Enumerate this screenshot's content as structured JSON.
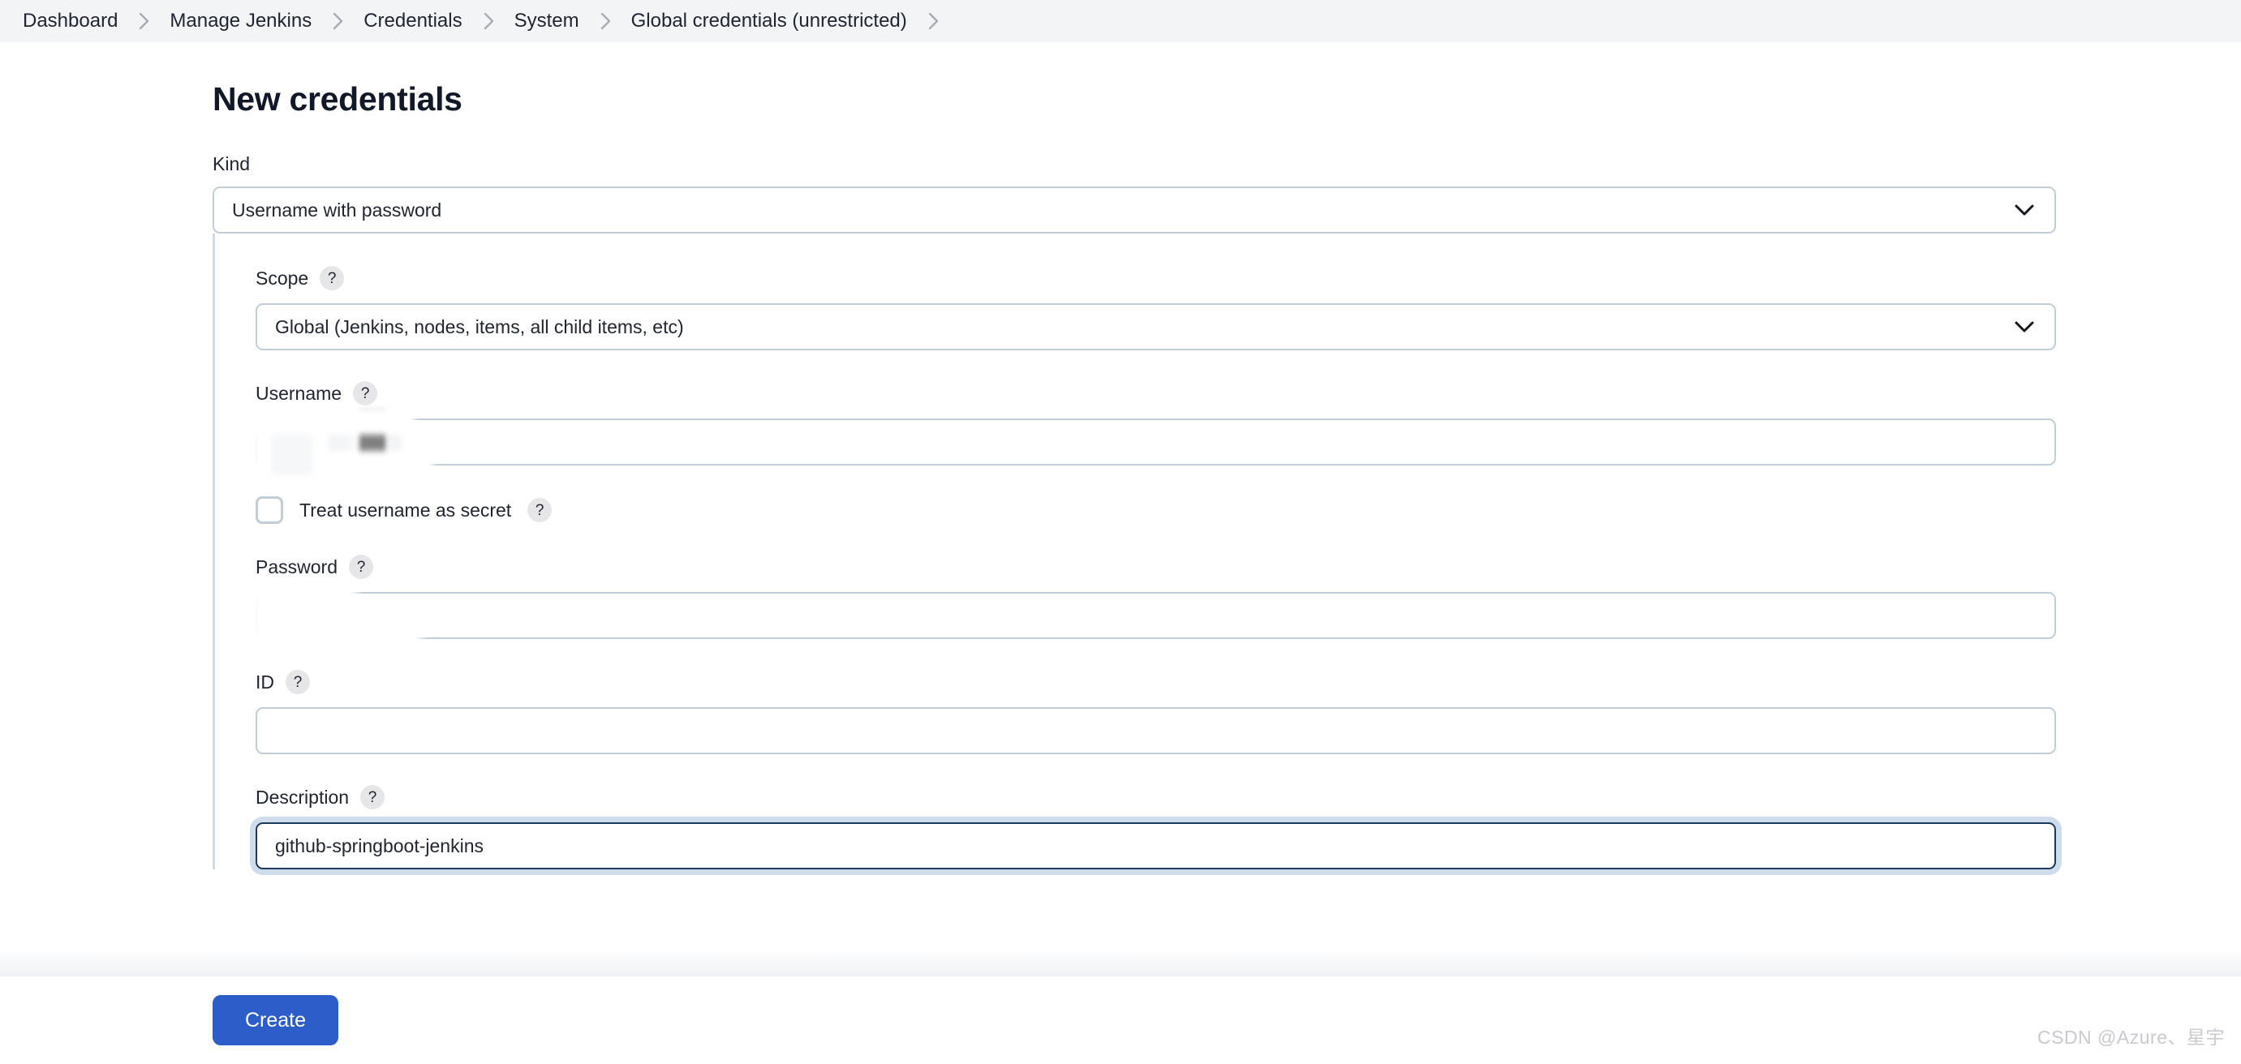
{
  "breadcrumb": {
    "items": [
      {
        "label": "Dashboard"
      },
      {
        "label": "Manage Jenkins"
      },
      {
        "label": "Credentials"
      },
      {
        "label": "System"
      },
      {
        "label": "Global credentials (unrestricted)"
      }
    ],
    "separator_icon": "chevron-right-icon"
  },
  "page": {
    "title": "New credentials"
  },
  "form": {
    "kind": {
      "label": "Kind",
      "value": "Username with password",
      "icon": "chevron-down-icon"
    },
    "scope": {
      "label": "Scope",
      "help": "?",
      "value": "Global (Jenkins, nodes, items, all child items, etc)",
      "icon": "chevron-down-icon"
    },
    "username": {
      "label": "Username",
      "help": "?",
      "value": "",
      "redacted": true
    },
    "treat_username_as_secret": {
      "label": "Treat username as secret",
      "help": "?",
      "checked": false
    },
    "password": {
      "label": "Password",
      "help": "?",
      "value": "",
      "redacted": true
    },
    "id": {
      "label": "ID",
      "help": "?",
      "value": ""
    },
    "description": {
      "label": "Description",
      "help": "?",
      "value": "github-springboot-jenkins",
      "focused": true
    }
  },
  "footer": {
    "create_label": "Create"
  },
  "watermark": {
    "text": "CSDN @Azure、星宇"
  },
  "colors": {
    "accent": "#2c5dc9",
    "breadcrumb_bg": "#f3f4f6",
    "border": "#c3cdd5",
    "focus_border": "#1b3a5c",
    "focus_ring": "#cfdcec",
    "text": "#1f2430"
  }
}
